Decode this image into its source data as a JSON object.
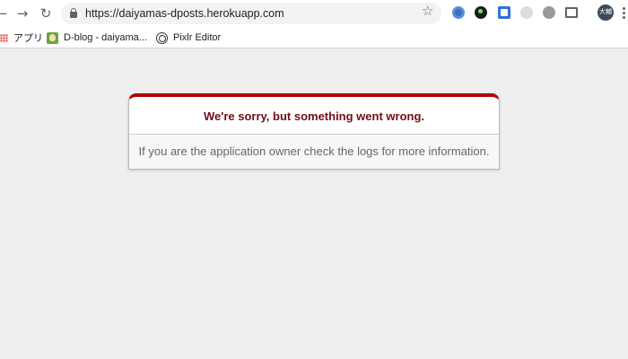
{
  "browser": {
    "url": "https://daiyamas-dposts.herokuapp.com",
    "avatar_text": "大輔",
    "nav_icons": [
      "back-icon",
      "forward-icon",
      "reload-icon"
    ],
    "extensions": [
      "extension-icon-1",
      "extension-icon-2",
      "extension-icon-3",
      "extension-icon-4",
      "extension-icon-5",
      "cast-icon"
    ]
  },
  "bookmarks": [
    {
      "label": "アプリ",
      "icon": "apps-grid-icon"
    },
    {
      "label": "D-blog - daiyama...",
      "icon": "dblog-favicon"
    },
    {
      "label": "Pixlr Editor",
      "icon": "pixlr-favicon"
    }
  ],
  "error": {
    "title": "We're sorry, but something went wrong.",
    "message": "If you are the application owner check the logs for more information.",
    "accent_color": "#b00100",
    "title_color": "#730e15"
  }
}
